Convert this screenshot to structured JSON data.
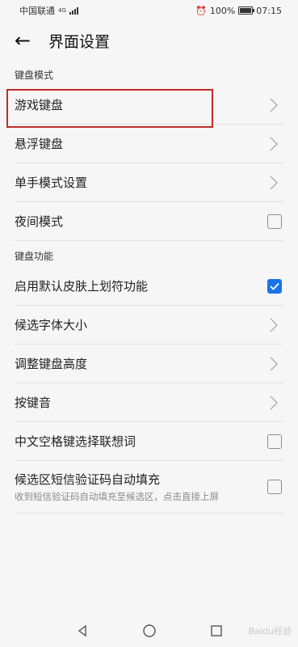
{
  "status": {
    "carrier": "中国联通",
    "network": "4G",
    "battery": "100%",
    "time": "07:15"
  },
  "header": {
    "title": "界面设置"
  },
  "sections": [
    {
      "header": "键盘模式",
      "items": [
        {
          "label": "游戏键盘",
          "control": "chevron",
          "highlighted": true
        },
        {
          "label": "悬浮键盘",
          "control": "chevron"
        },
        {
          "label": "单手模式设置",
          "control": "chevron"
        },
        {
          "label": "夜间模式",
          "control": "checkbox",
          "checked": false
        }
      ]
    },
    {
      "header": "键盘功能",
      "items": [
        {
          "label": "启用默认皮肤上划符功能",
          "control": "checkbox",
          "checked": true
        },
        {
          "label": "候选字体大小",
          "control": "chevron"
        },
        {
          "label": "调整键盘高度",
          "control": "chevron"
        },
        {
          "label": "按键音",
          "control": "chevron"
        },
        {
          "label": "中文空格键选择联想词",
          "control": "checkbox",
          "checked": false
        },
        {
          "label": "候选区短信验证码自动填充",
          "subtitle": "收到短信验证码自动填充至候选区，点击直接上屏",
          "control": "checkbox",
          "checked": false
        }
      ]
    }
  ],
  "watermark": "Baidu经验",
  "colors": {
    "accent": "#1a73e8",
    "highlight": "#c22b2b",
    "background": "#f6f6f6"
  }
}
